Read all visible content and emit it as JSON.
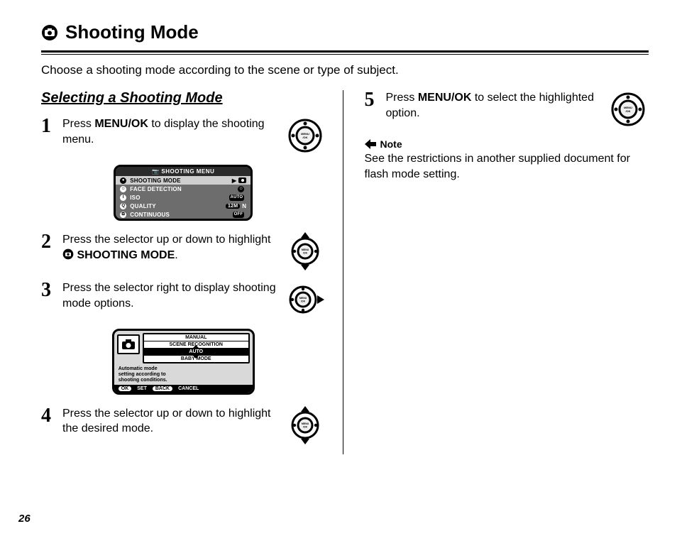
{
  "page_number": "26",
  "title": "Shooting Mode",
  "intro": "Choose a shooting mode according to the scene or type of subject.",
  "subhead": "Selecting a Shooting Mode",
  "steps": {
    "s1": {
      "num": "1",
      "text_a": "Press ",
      "bold": "MENU/OK",
      "text_b": " to display the shooting menu."
    },
    "s2": {
      "num": "2",
      "text_a": "Press the selector up or down to highlight ",
      "bold": "SHOOTING MODE",
      "text_b": "."
    },
    "s3": {
      "num": "3",
      "text": "Press the selector right to display shooting mode options."
    },
    "s4": {
      "num": "4",
      "text": "Press the selector up or down to highlight the desired mode."
    },
    "s5": {
      "num": "5",
      "text_a": "Press ",
      "bold": "MENU/OK",
      "text_b": " to select the highlighted option."
    }
  },
  "note": {
    "label": "Note",
    "body": "See the restrictions in another supplied document for flash mode setting."
  },
  "menu_screen": {
    "header": "SHOOTING MENU",
    "rows": [
      {
        "label": "SHOOTING MODE",
        "selected": true
      },
      {
        "label": "FACE DETECTION",
        "value": ""
      },
      {
        "label": "ISO",
        "value": "AUTO"
      },
      {
        "label": "QUALITY",
        "value": "12M N"
      },
      {
        "label": "CONTINUOUS",
        "value": "OFF"
      }
    ]
  },
  "opt_screen": {
    "items": [
      "MANUAL",
      "SCENE RECOGNITION",
      "AUTO",
      "BABY MODE"
    ],
    "selected": "AUTO",
    "desc_l1": "Automatic mode",
    "desc_l2": "setting according to",
    "desc_l3": "shooting conditions.",
    "footer_set": "SET",
    "footer_ok": "OK",
    "footer_cancel": "CANCEL",
    "footer_back": "BACK"
  }
}
